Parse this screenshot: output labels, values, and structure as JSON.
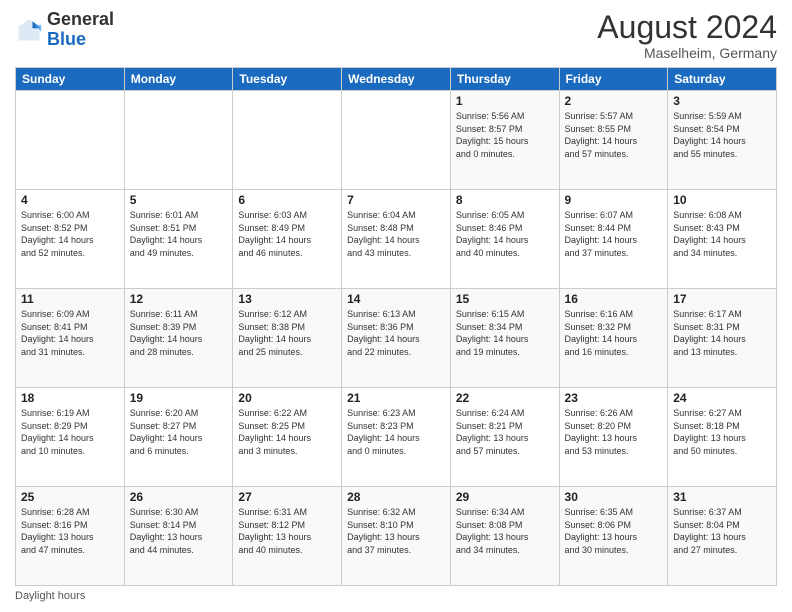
{
  "header": {
    "logo": {
      "general": "General",
      "blue": "Blue"
    },
    "title": "August 2024",
    "location": "Maselheim, Germany"
  },
  "days_of_week": [
    "Sunday",
    "Monday",
    "Tuesday",
    "Wednesday",
    "Thursday",
    "Friday",
    "Saturday"
  ],
  "footer": {
    "daylight_hours": "Daylight hours"
  },
  "weeks": [
    [
      {
        "day": "",
        "info": ""
      },
      {
        "day": "",
        "info": ""
      },
      {
        "day": "",
        "info": ""
      },
      {
        "day": "",
        "info": ""
      },
      {
        "day": "1",
        "info": "Sunrise: 5:56 AM\nSunset: 8:57 PM\nDaylight: 15 hours\nand 0 minutes."
      },
      {
        "day": "2",
        "info": "Sunrise: 5:57 AM\nSunset: 8:55 PM\nDaylight: 14 hours\nand 57 minutes."
      },
      {
        "day": "3",
        "info": "Sunrise: 5:59 AM\nSunset: 8:54 PM\nDaylight: 14 hours\nand 55 minutes."
      }
    ],
    [
      {
        "day": "4",
        "info": "Sunrise: 6:00 AM\nSunset: 8:52 PM\nDaylight: 14 hours\nand 52 minutes."
      },
      {
        "day": "5",
        "info": "Sunrise: 6:01 AM\nSunset: 8:51 PM\nDaylight: 14 hours\nand 49 minutes."
      },
      {
        "day": "6",
        "info": "Sunrise: 6:03 AM\nSunset: 8:49 PM\nDaylight: 14 hours\nand 46 minutes."
      },
      {
        "day": "7",
        "info": "Sunrise: 6:04 AM\nSunset: 8:48 PM\nDaylight: 14 hours\nand 43 minutes."
      },
      {
        "day": "8",
        "info": "Sunrise: 6:05 AM\nSunset: 8:46 PM\nDaylight: 14 hours\nand 40 minutes."
      },
      {
        "day": "9",
        "info": "Sunrise: 6:07 AM\nSunset: 8:44 PM\nDaylight: 14 hours\nand 37 minutes."
      },
      {
        "day": "10",
        "info": "Sunrise: 6:08 AM\nSunset: 8:43 PM\nDaylight: 14 hours\nand 34 minutes."
      }
    ],
    [
      {
        "day": "11",
        "info": "Sunrise: 6:09 AM\nSunset: 8:41 PM\nDaylight: 14 hours\nand 31 minutes."
      },
      {
        "day": "12",
        "info": "Sunrise: 6:11 AM\nSunset: 8:39 PM\nDaylight: 14 hours\nand 28 minutes."
      },
      {
        "day": "13",
        "info": "Sunrise: 6:12 AM\nSunset: 8:38 PM\nDaylight: 14 hours\nand 25 minutes."
      },
      {
        "day": "14",
        "info": "Sunrise: 6:13 AM\nSunset: 8:36 PM\nDaylight: 14 hours\nand 22 minutes."
      },
      {
        "day": "15",
        "info": "Sunrise: 6:15 AM\nSunset: 8:34 PM\nDaylight: 14 hours\nand 19 minutes."
      },
      {
        "day": "16",
        "info": "Sunrise: 6:16 AM\nSunset: 8:32 PM\nDaylight: 14 hours\nand 16 minutes."
      },
      {
        "day": "17",
        "info": "Sunrise: 6:17 AM\nSunset: 8:31 PM\nDaylight: 14 hours\nand 13 minutes."
      }
    ],
    [
      {
        "day": "18",
        "info": "Sunrise: 6:19 AM\nSunset: 8:29 PM\nDaylight: 14 hours\nand 10 minutes."
      },
      {
        "day": "19",
        "info": "Sunrise: 6:20 AM\nSunset: 8:27 PM\nDaylight: 14 hours\nand 6 minutes."
      },
      {
        "day": "20",
        "info": "Sunrise: 6:22 AM\nSunset: 8:25 PM\nDaylight: 14 hours\nand 3 minutes."
      },
      {
        "day": "21",
        "info": "Sunrise: 6:23 AM\nSunset: 8:23 PM\nDaylight: 14 hours\nand 0 minutes."
      },
      {
        "day": "22",
        "info": "Sunrise: 6:24 AM\nSunset: 8:21 PM\nDaylight: 13 hours\nand 57 minutes."
      },
      {
        "day": "23",
        "info": "Sunrise: 6:26 AM\nSunset: 8:20 PM\nDaylight: 13 hours\nand 53 minutes."
      },
      {
        "day": "24",
        "info": "Sunrise: 6:27 AM\nSunset: 8:18 PM\nDaylight: 13 hours\nand 50 minutes."
      }
    ],
    [
      {
        "day": "25",
        "info": "Sunrise: 6:28 AM\nSunset: 8:16 PM\nDaylight: 13 hours\nand 47 minutes."
      },
      {
        "day": "26",
        "info": "Sunrise: 6:30 AM\nSunset: 8:14 PM\nDaylight: 13 hours\nand 44 minutes."
      },
      {
        "day": "27",
        "info": "Sunrise: 6:31 AM\nSunset: 8:12 PM\nDaylight: 13 hours\nand 40 minutes."
      },
      {
        "day": "28",
        "info": "Sunrise: 6:32 AM\nSunset: 8:10 PM\nDaylight: 13 hours\nand 37 minutes."
      },
      {
        "day": "29",
        "info": "Sunrise: 6:34 AM\nSunset: 8:08 PM\nDaylight: 13 hours\nand 34 minutes."
      },
      {
        "day": "30",
        "info": "Sunrise: 6:35 AM\nSunset: 8:06 PM\nDaylight: 13 hours\nand 30 minutes."
      },
      {
        "day": "31",
        "info": "Sunrise: 6:37 AM\nSunset: 8:04 PM\nDaylight: 13 hours\nand 27 minutes."
      }
    ]
  ]
}
